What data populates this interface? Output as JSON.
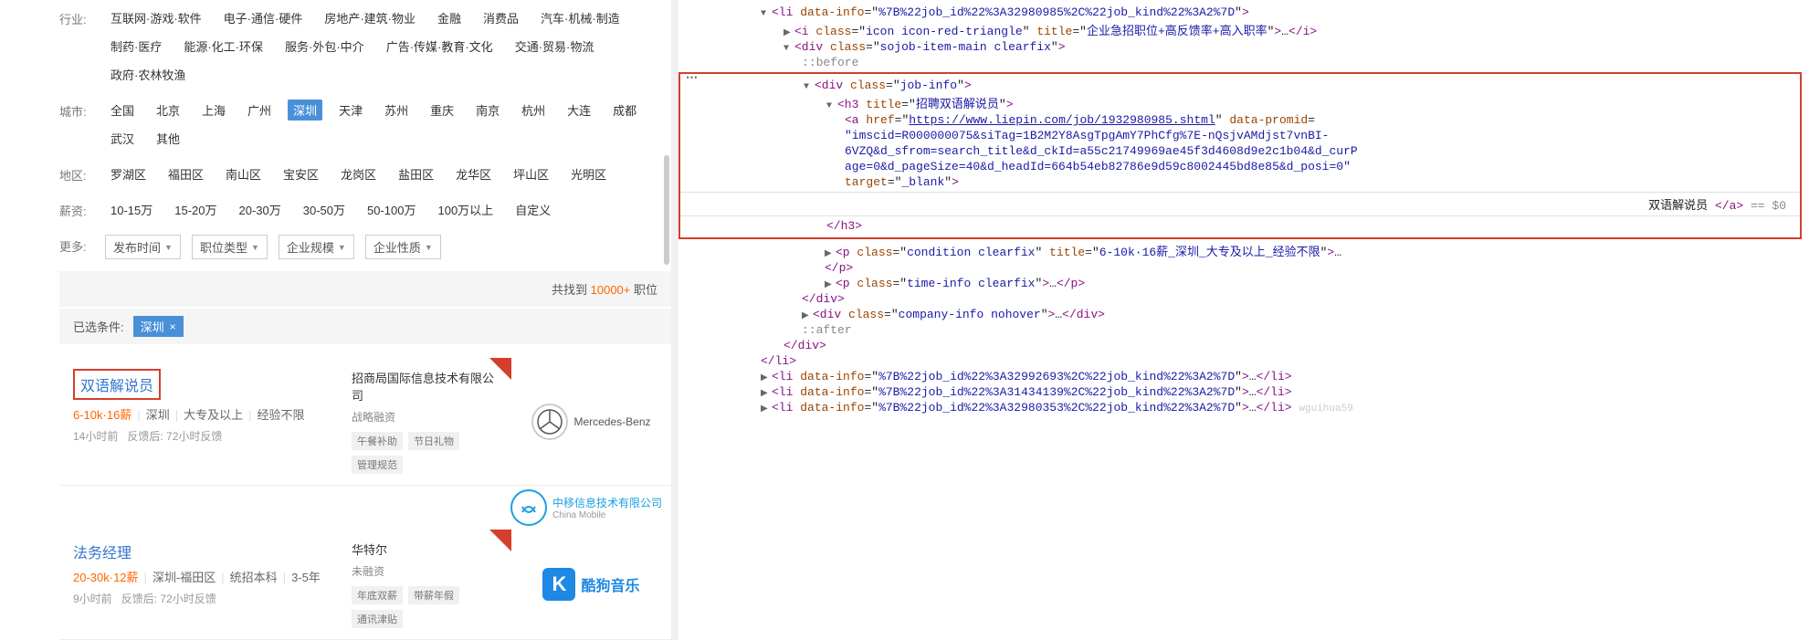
{
  "filters": {
    "industry": {
      "label": "行业:",
      "items": [
        "互联网·游戏·软件",
        "电子·通信·硬件",
        "房地产·建筑·物业",
        "金融",
        "消费品",
        "汽车·机械·制造",
        "制药·医疗",
        "能源·化工·环保",
        "服务·外包·中介",
        "广告·传媒·教育·文化",
        "交通·贸易·物流",
        "政府·农林牧渔"
      ]
    },
    "city": {
      "label": "城市:",
      "items": [
        "全国",
        "北京",
        "上海",
        "广州",
        "深圳",
        "天津",
        "苏州",
        "重庆",
        "南京",
        "杭州",
        "大连",
        "成都",
        "武汉",
        "其他"
      ],
      "active_index": 4
    },
    "region": {
      "label": "地区:",
      "items": [
        "罗湖区",
        "福田区",
        "南山区",
        "宝安区",
        "龙岗区",
        "盐田区",
        "龙华区",
        "坪山区",
        "光明区"
      ]
    },
    "salary": {
      "label": "薪资:",
      "items": [
        "10-15万",
        "15-20万",
        "20-30万",
        "30-50万",
        "50-100万",
        "100万以上",
        "自定义"
      ]
    },
    "more": {
      "label": "更多:",
      "dropdowns": [
        "发布时间",
        "职位类型",
        "企业规模",
        "企业性质"
      ],
      "tri": "▼"
    }
  },
  "summary": {
    "prefix": "共找到 ",
    "count": "10000+",
    "suffix": " 职位"
  },
  "conditions": {
    "label": "已选条件:",
    "tags": [
      "深圳"
    ],
    "x": "×"
  },
  "jobs": [
    {
      "title": "双语解说员",
      "salary": "6-10k·16薪",
      "loc": "深圳",
      "edu": "大专及以上",
      "exp": "经验不限",
      "time1": "14小时前",
      "time2": "反馈后: 72小时反馈",
      "company": "招商局国际信息技术有限公司",
      "stage": "战略融资",
      "tags": [
        "午餐补助",
        "节日礼物",
        "管理规范"
      ],
      "logo_name": "Mercedes-Benz",
      "logo_kind": "mb"
    },
    {
      "title": "法务经理",
      "salary": "20-30k·12薪",
      "loc": "深圳-福田区",
      "edu": "统招本科",
      "exp": "3-5年",
      "time1": "9小时前",
      "time2": "反馈后: 72小时反馈",
      "company": "华特尔",
      "stage": "未融资",
      "tags": [
        "年底双薪",
        "带薪年假",
        "通讯津贴"
      ],
      "logo_name": "酷狗音乐",
      "logo_kind": "kugou"
    }
  ],
  "side_logos": {
    "cm_top": "中移信息技术有限公司",
    "cm_bot": "China Mobile",
    "k": "K"
  },
  "dev": {
    "li_data_info": "%7B%22job_id%22%3A32980985%2C%22job_kind%22%3A2%7D",
    "i_class": "icon icon-red-triangle",
    "i_title": "企业急招职位+高反馈率+高入职率",
    "div_main_class": "sojob-item-main clearfix",
    "pseudo_before": "::before",
    "job_info_class": "job-info",
    "h3_title": "招聘双语解说员",
    "a_href": "https://www.liepin.com/job/1932980985.shtml",
    "a_data_promid_l1": "\"imscid=R000000075&siTag=1B2M2Y8AsgTpgAmY7PhCfg%7E-nQsjvAMdjst7vnBI-",
    "a_data_promid_l2": "6VZQ&d_sfrom=search_title&d_ckId=a55c21749969ae45f3d4608d9e2c1b04&d_curP",
    "a_data_promid_l3": "age=0&d_pageSize=40&d_headId=664b54eb82786e9d59c8002445bd8e85&d_posi=0\"",
    "a_target": "_blank",
    "a_text": "双语解说员",
    "a_end": "</a>",
    "eq0": " == $0",
    "p_cond_class": "condition clearfix",
    "p_cond_title": "6-10k·16薪_深圳_大专及以上_经验不限",
    "p_time_class": "time-info clearfix",
    "company_info_class": "company-info nohover",
    "pseudo_after": "::after",
    "li2": "%7B%22job_id%22%3A32992693%2C%22job_kind%22%3A2%7D",
    "li3": "%7B%22job_id%22%3A31434139%2C%22job_kind%22%3A2%7D",
    "li4": "%7B%22job_id%22%3A32980353%2C%22job_kind%22%3A2%7D",
    "dots": "…",
    "watermark": "wguihua59"
  }
}
